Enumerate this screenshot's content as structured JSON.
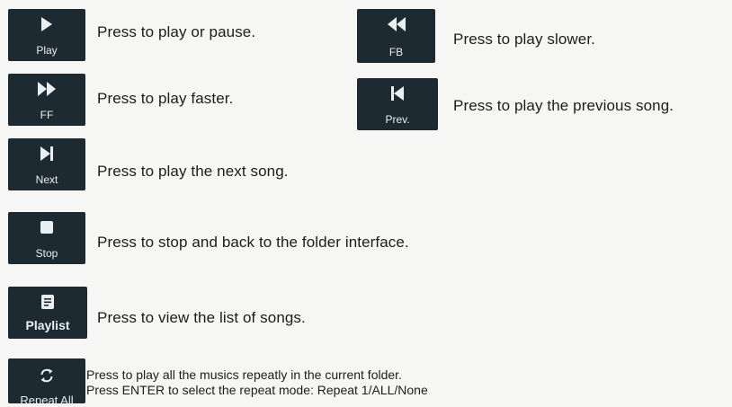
{
  "controls": [
    {
      "key_label": "Play",
      "icon": "play-icon",
      "description": "Press to play or pause."
    },
    {
      "key_label": "FB",
      "icon": "fast-backward-icon",
      "description": "Press to play slower."
    },
    {
      "key_label": "FF",
      "icon": "fast-forward-icon",
      "description": "Press to play faster."
    },
    {
      "key_label": "Prev.",
      "icon": "previous-track-icon",
      "description": "Press to play the previous song."
    },
    {
      "key_label": "Next",
      "icon": "next-track-icon",
      "description": "Press to play the next song."
    },
    {
      "key_label": "Stop",
      "icon": "stop-icon",
      "description": "Press to stop and back to the folder interface."
    },
    {
      "key_label": "Playlist",
      "icon": "playlist-icon",
      "description": "Press to view the list of songs."
    },
    {
      "key_label": "Repeat All",
      "icon": "repeat-icon",
      "description_lines": [
        "Press to play all the musics repeatly in the current folder.",
        "Press ENTER to select the repeat mode: Repeat 1/ALL/None"
      ]
    }
  ],
  "colors": {
    "key_background": "#1e2a32",
    "key_text": "#e9eef1",
    "page_background": "#f6f6f4",
    "text": "#1c1c1c"
  }
}
